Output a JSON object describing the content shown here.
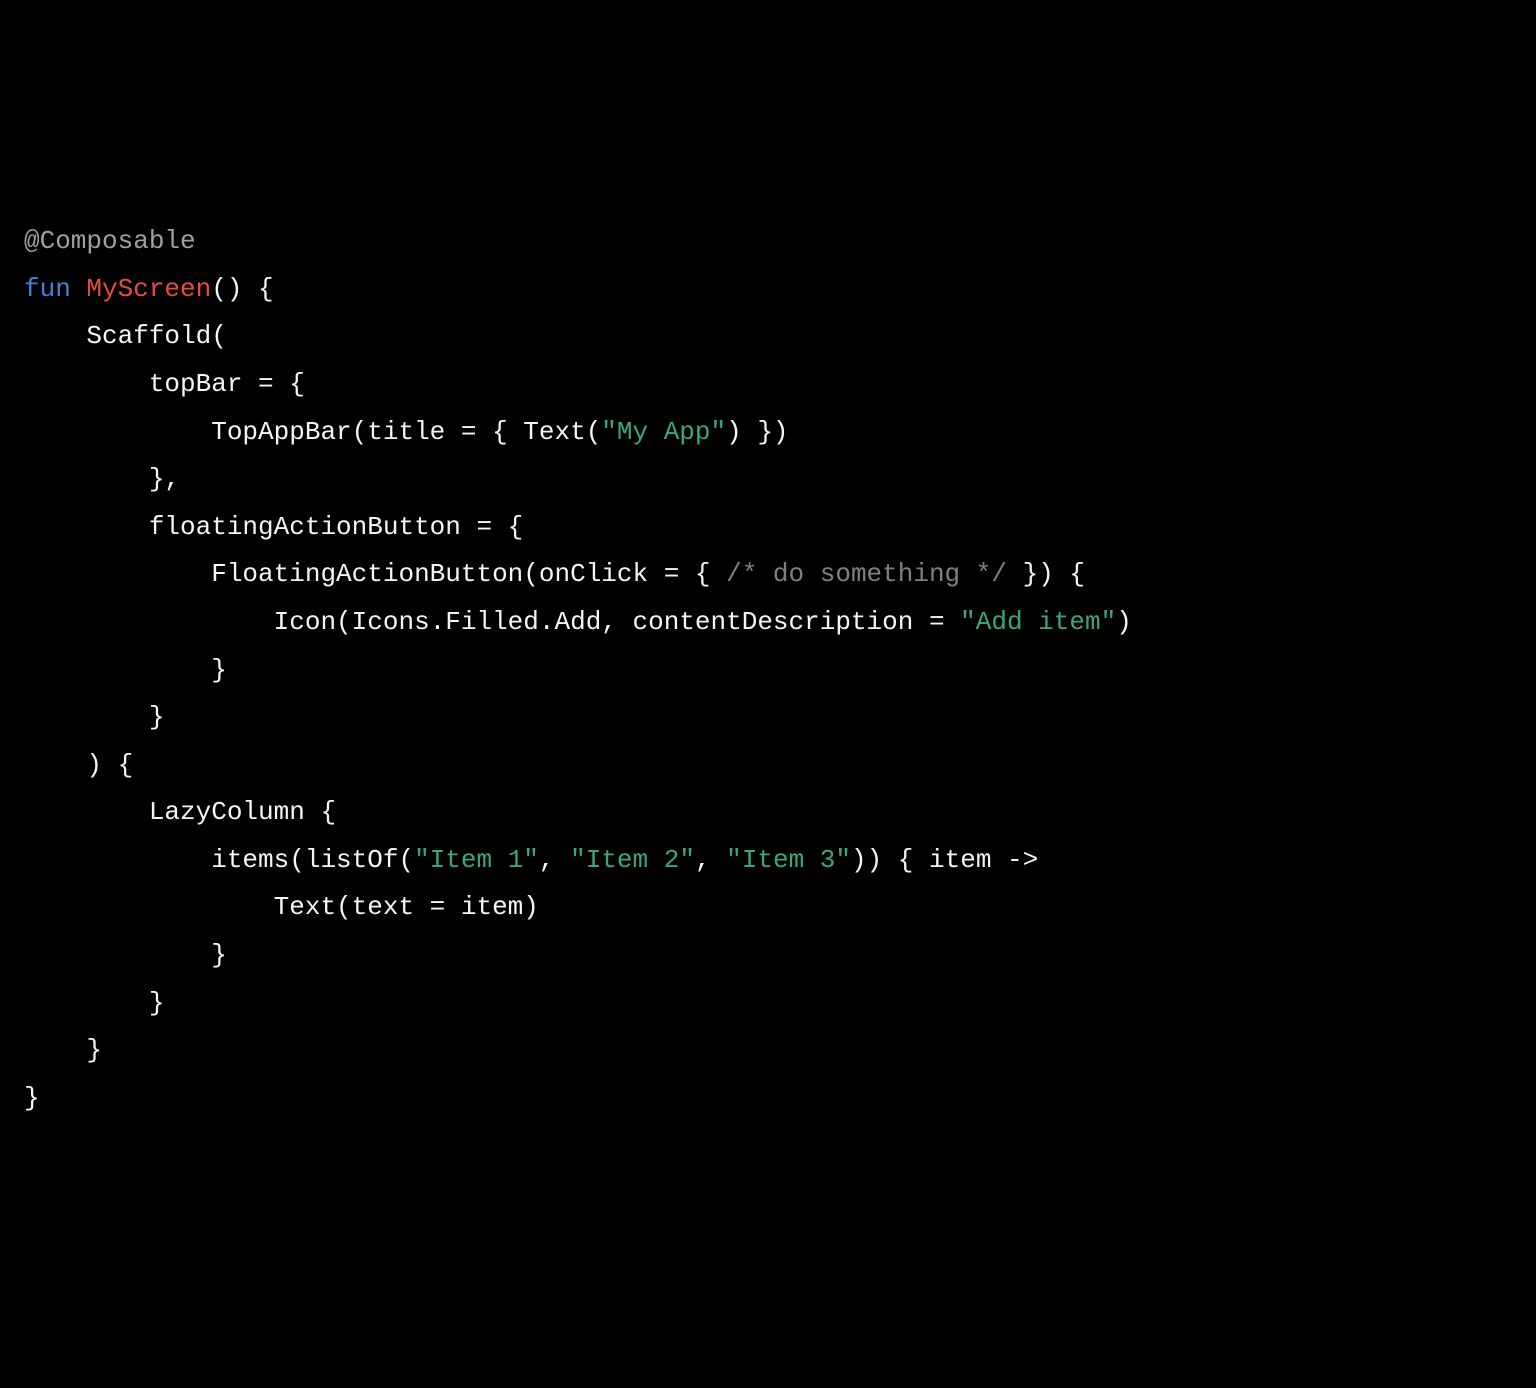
{
  "code": {
    "line1": {
      "t1": "@Composable"
    },
    "line2": {
      "t1": "fun",
      "t2": " ",
      "t3": "MyScreen",
      "t4": "() {"
    },
    "line3": {
      "t1": "    Scaffold("
    },
    "line4": {
      "t1": "        topBar = {"
    },
    "line5": {
      "t1": "            TopAppBar(title = { Text(",
      "t2": "\"My App\"",
      "t3": ") })"
    },
    "line6": {
      "t1": "        },"
    },
    "line7": {
      "t1": "        floatingActionButton = {"
    },
    "line8": {
      "t1": "            FloatingActionButton(onClick = { ",
      "t2": "/* do something */",
      "t3": " }) {"
    },
    "line9": {
      "t1": "                Icon(Icons.Filled.Add, contentDescription = ",
      "t2": "\"Add item\"",
      "t3": ")"
    },
    "line10": {
      "t1": "            }"
    },
    "line11": {
      "t1": "        }"
    },
    "line12": {
      "t1": "    ) {"
    },
    "line13": {
      "t1": "        LazyColumn {"
    },
    "line14": {
      "t1": "            items(listOf(",
      "t2": "\"Item 1\"",
      "t3": ", ",
      "t4": "\"Item 2\"",
      "t5": ", ",
      "t6": "\"Item 3\"",
      "t7": ")) { item ->"
    },
    "line15": {
      "t1": "                Text(text = item)"
    },
    "line16": {
      "t1": "            }"
    },
    "line17": {
      "t1": "        }"
    },
    "line18": {
      "t1": "    }"
    },
    "line19": {
      "t1": "}"
    }
  }
}
